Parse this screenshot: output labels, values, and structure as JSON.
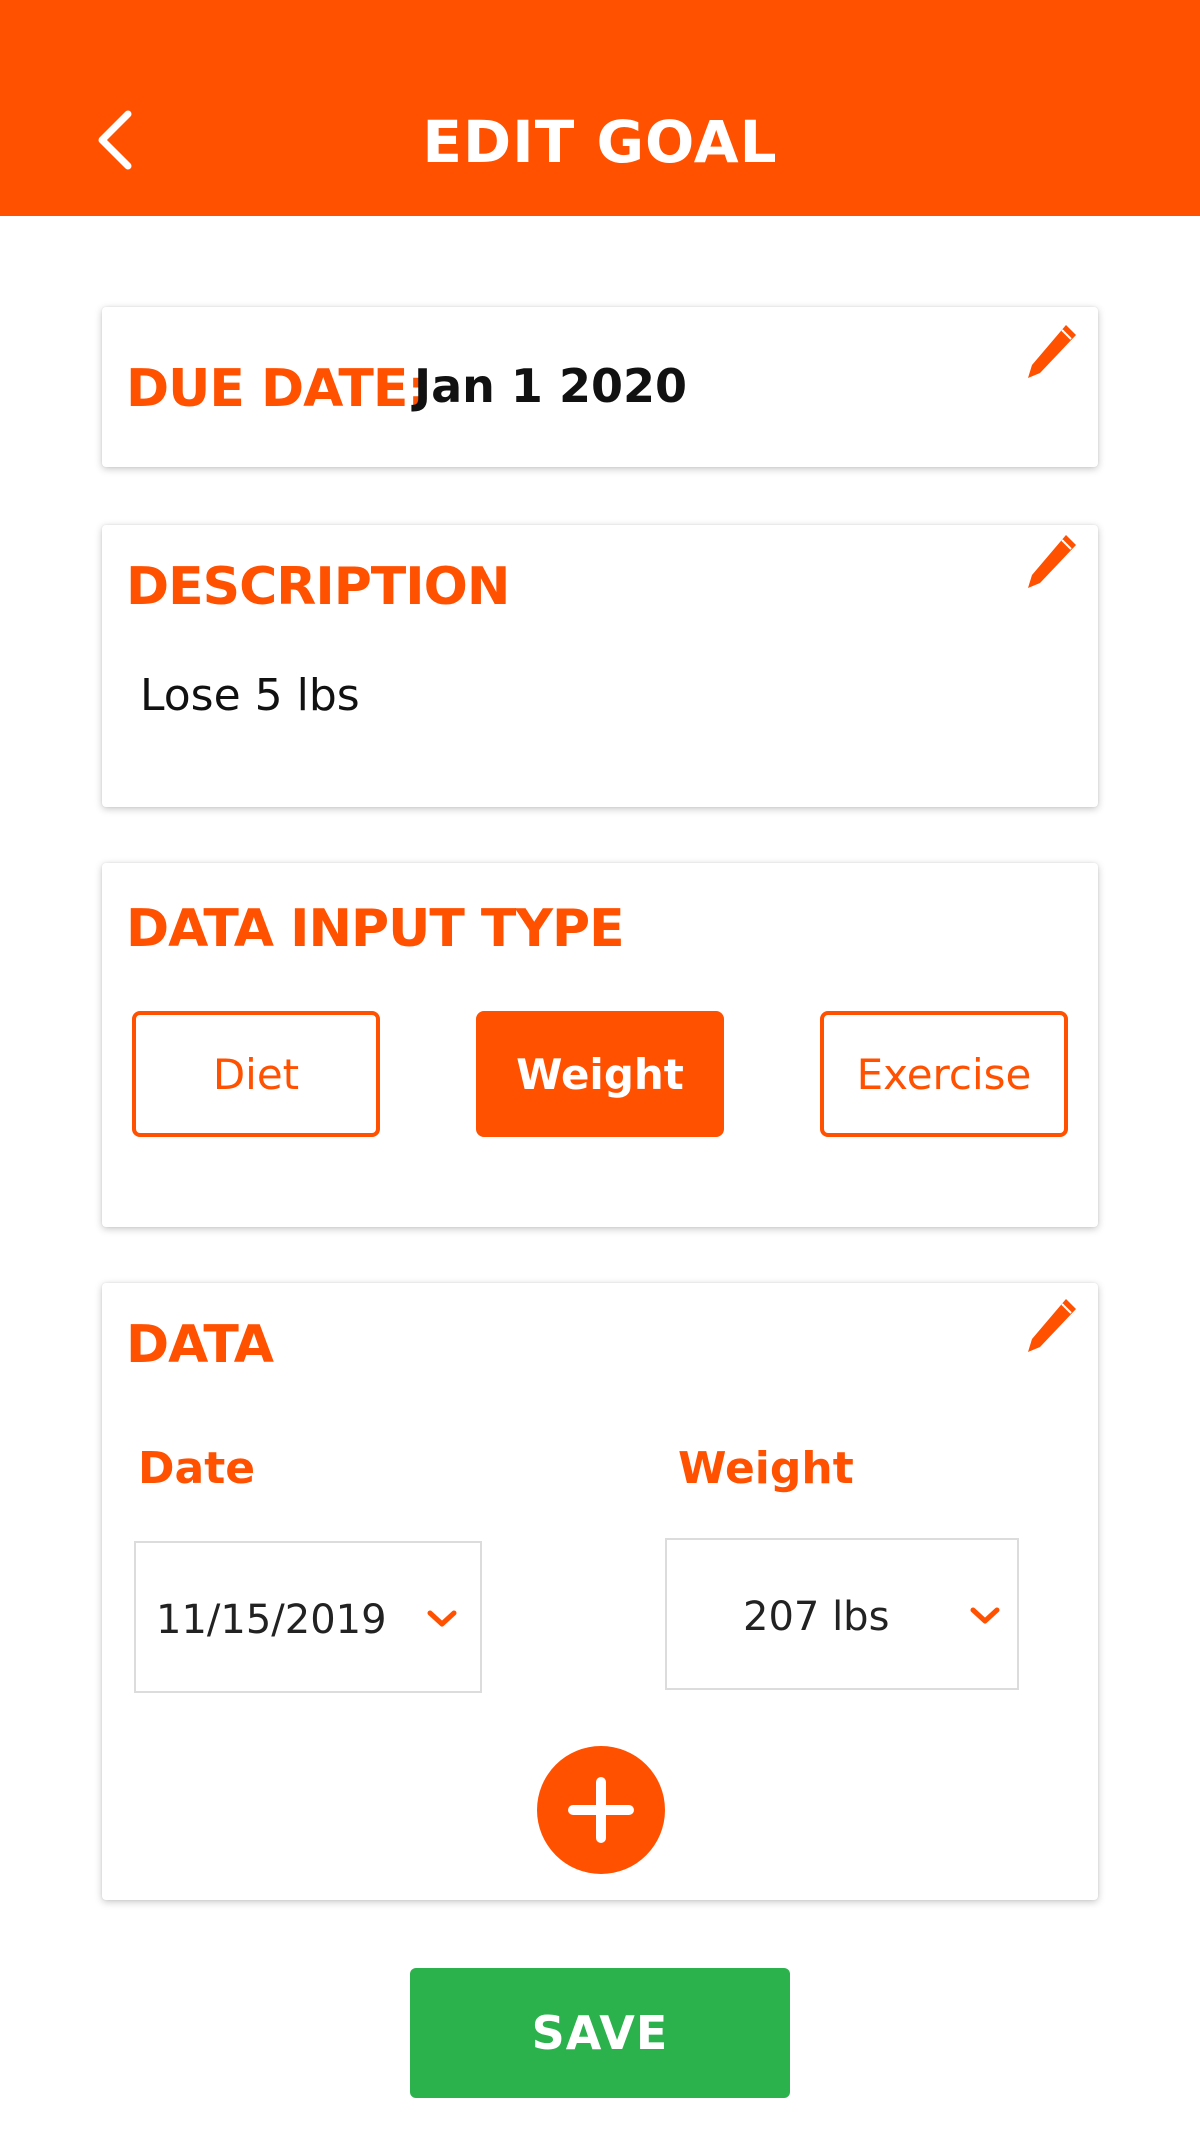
{
  "header": {
    "title": "EDIT GOAL",
    "back_icon": "chevron-left-icon",
    "background": "#FF5100"
  },
  "due_date": {
    "label": "DUE DATE:",
    "value": "Jan 1 2020",
    "edit_icon": "pencil-icon"
  },
  "description": {
    "label": "DESCRIPTION",
    "value": "Lose 5 lbs",
    "edit_icon": "pencil-icon"
  },
  "data_input_type": {
    "label": "DATA INPUT TYPE",
    "options": [
      {
        "label": "Diet",
        "selected": false
      },
      {
        "label": "Weight",
        "selected": true
      },
      {
        "label": "Exercise",
        "selected": false
      }
    ]
  },
  "data": {
    "label": "DATA",
    "edit_icon": "pencil-icon",
    "date_label": "Date",
    "weight_label": "Weight",
    "date_value": "11/15/2019",
    "weight_value": "207 lbs",
    "dropdown_icon": "chevron-down-icon",
    "add_icon": "plus-icon"
  },
  "save": {
    "label": "SAVE",
    "color": "#2BB24C"
  },
  "colors": {
    "accent": "#FF5100",
    "field_border": "#dcdcdc"
  }
}
